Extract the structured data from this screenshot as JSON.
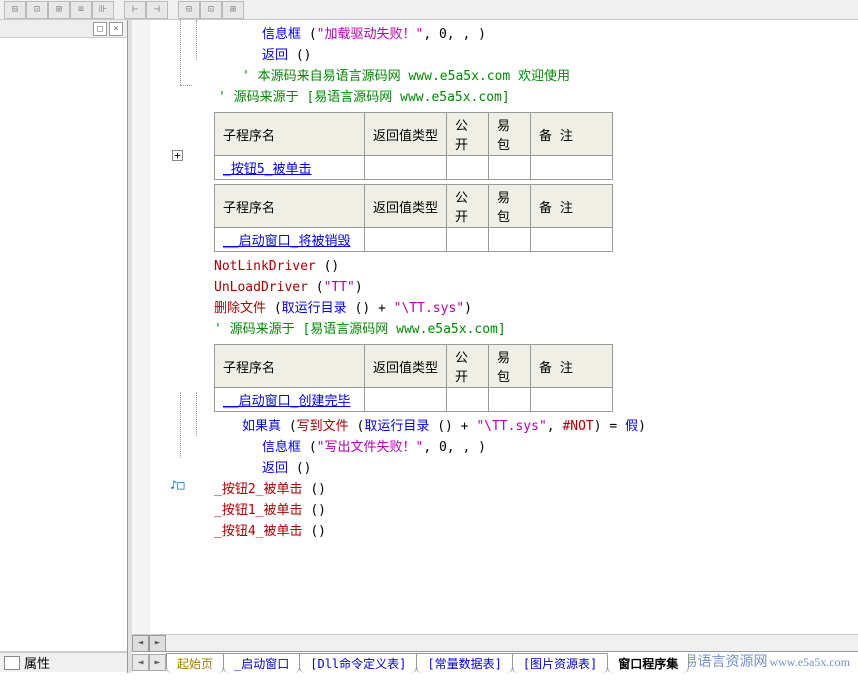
{
  "toolbar": {
    "buttons": [
      "⊟",
      "⊡",
      "⊞",
      "≡",
      "⊪",
      "|",
      "⊢",
      "⊣",
      "|",
      "⊟",
      "⊡",
      "⊞"
    ]
  },
  "leftpanel": {
    "footer_label": "属性"
  },
  "code": {
    "l1a": "信息框",
    "l1b": "(",
    "l1c": "\"加载驱动失败！\"",
    "l1d": ", 0, , )",
    "l2": "返回",
    "l2b": "()",
    "l3": "' 本源码来自易语言源码网 www.e5a5x.com  欢迎使用",
    "l4": "' 源码来源于 [易语言源码网 www.e5a5x.com]",
    "l5a": "NotLinkDriver",
    "l5b": "()",
    "l6a": "UnLoadDriver",
    "l6b": "(",
    "l6c": "\"TT\"",
    "l6d": ")",
    "l7a": "删除文件",
    "l7b": "(",
    "l7c": "取运行目录",
    "l7d": "()",
    "l7e": " + ",
    "l7f": "\"\\TT.sys\"",
    "l7g": ")",
    "l8": "' 源码来源于 [易语言源码网 www.e5a5x.com]",
    "l9a": "如果真",
    "l9b": "(",
    "l9c": "写到文件",
    "l9d": "(",
    "l9e": "取运行目录",
    "l9f": "()",
    "l9g": " + ",
    "l9h": "\"\\TT.sys\"",
    "l9i": ", ",
    "l9j": "#NOT",
    "l9k": ")",
    "l9l": " = ",
    "l9m": "假",
    "l9n": ")",
    "l10a": "信息框",
    "l10b": "(",
    "l10c": "\"写出文件失败！\"",
    "l10d": ", 0, , )",
    "l11": "返回",
    "l11b": "()",
    "l12a": "_按钮2_被单击",
    "l12b": "()",
    "l13a": "_按钮1_被单击",
    "l13b": "()",
    "l14a": "_按钮4_被单击",
    "l14b": "()"
  },
  "tables": {
    "headers": {
      "c1": "子程序名",
      "c2": "返回值类型",
      "c3": "公开",
      "c4": "易包",
      "c5": "备 注"
    },
    "t1": {
      "name": "_按钮5_被单击"
    },
    "t2": {
      "name": "__启动窗口_将被销毁"
    },
    "t3": {
      "name": "__启动窗口_创建完毕"
    }
  },
  "tabs": {
    "items": [
      {
        "label": "起始页",
        "cls": "gold"
      },
      {
        "label": "_启动窗口",
        "cls": "blue"
      },
      {
        "label": "[Dll命令定义表]",
        "cls": "blue"
      },
      {
        "label": "[常量数据表]",
        "cls": "blue"
      },
      {
        "label": "[图片资源表]",
        "cls": "blue"
      },
      {
        "label": "窗口程序集",
        "cls": "active"
      }
    ]
  },
  "watermark": {
    "title": "易语言资源网",
    "url": "www.e5a5x.com"
  }
}
